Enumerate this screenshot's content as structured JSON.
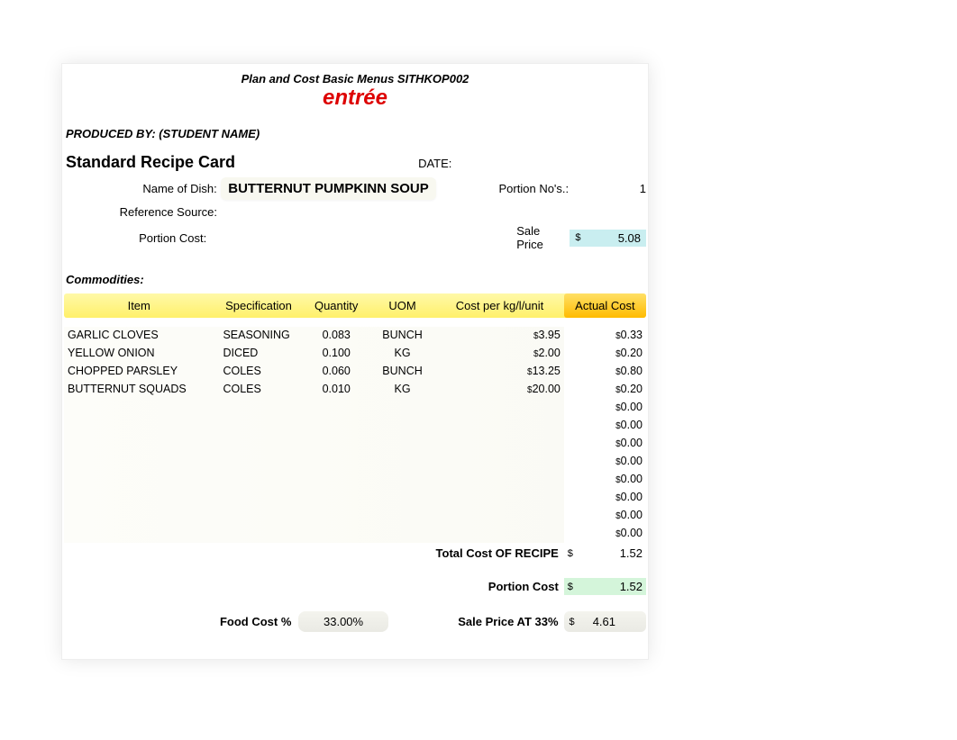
{
  "header": {
    "course_title": "Plan and Cost Basic Menus SITHKOP002",
    "entree_label": "entrée",
    "produced_by": "PRODUCED BY: (STUDENT NAME)"
  },
  "card": {
    "title": "Standard Recipe Card",
    "date_label": "DATE:",
    "name_label": "Name of Dish:",
    "name_value": "BUTTERNUT PUMPKINN SOUP",
    "portion_nos_label": "Portion No's.:",
    "portion_nos_value": "1",
    "reference_label": "Reference Source:",
    "portion_cost_label": "Portion Cost:",
    "sale_price_label": "Sale Price",
    "sale_price_value": "5.08"
  },
  "commodities_label": "Commodities:",
  "table": {
    "headers": {
      "item": "Item",
      "spec": "Specification",
      "qty": "Quantity",
      "uom": "UOM",
      "cpu": "Cost per kg/l/unit",
      "actual": "Actual Cost"
    },
    "rows": [
      {
        "item": "GARLIC CLOVES",
        "spec": "SEASONING",
        "qty": "0.083",
        "uom": "BUNCH",
        "cpu": "3.95",
        "actual": "0.33"
      },
      {
        "item": "YELLOW ONION",
        "spec": "DICED",
        "qty": "0.100",
        "uom": "KG",
        "cpu": "2.00",
        "actual": "0.20"
      },
      {
        "item": "CHOPPED PARSLEY",
        "spec": "COLES",
        "qty": "0.060",
        "uom": "BUNCH",
        "cpu": "13.25",
        "actual": "0.80"
      },
      {
        "item": "BUTTERNUT SQUADS",
        "spec": "COLES",
        "qty": "0.010",
        "uom": "KG",
        "cpu": "20.00",
        "actual": "0.20"
      },
      {
        "item": "",
        "spec": "",
        "qty": "",
        "uom": "",
        "cpu": "",
        "actual": "0.00"
      },
      {
        "item": "",
        "spec": "",
        "qty": "",
        "uom": "",
        "cpu": "",
        "actual": "0.00"
      },
      {
        "item": "",
        "spec": "",
        "qty": "",
        "uom": "",
        "cpu": "",
        "actual": "0.00"
      },
      {
        "item": "",
        "spec": "",
        "qty": "",
        "uom": "",
        "cpu": "",
        "actual": "0.00"
      },
      {
        "item": "",
        "spec": "",
        "qty": "",
        "uom": "",
        "cpu": "",
        "actual": "0.00"
      },
      {
        "item": "",
        "spec": "",
        "qty": "",
        "uom": "",
        "cpu": "",
        "actual": "0.00"
      },
      {
        "item": "",
        "spec": "",
        "qty": "",
        "uom": "",
        "cpu": "",
        "actual": "0.00"
      },
      {
        "item": "",
        "spec": "",
        "qty": "",
        "uom": "",
        "cpu": "",
        "actual": "0.00"
      }
    ]
  },
  "totals": {
    "recipe_total_label": "Total Cost OF RECIPE",
    "recipe_total_value": "1.52",
    "portion_cost_label": "Portion Cost",
    "portion_cost_value": "1.52",
    "food_cost_pct_label": "Food Cost %",
    "food_cost_pct_value": "33.00%",
    "sale_at_33_label": "Sale Price AT 33%",
    "sale_at_33_value": "4.61"
  }
}
